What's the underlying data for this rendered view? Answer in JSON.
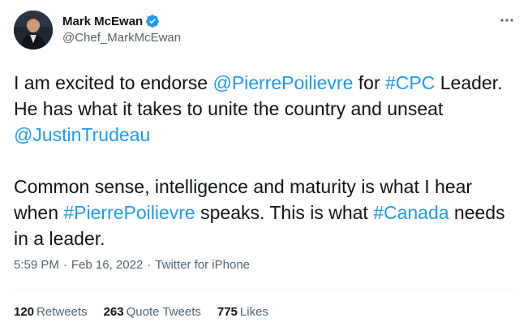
{
  "author": {
    "display_name": "Mark McEwan",
    "handle": "@Chef_MarkMcEwan",
    "verified": true,
    "avatar_icon": "profile-photo"
  },
  "tweet": {
    "p1_a": "I am excited to endorse ",
    "p1_mention1": "@PierrePoilievre",
    "p1_b": " for ",
    "p1_hashtag1": "#CPC",
    "p1_c": " Leader. He has what it takes to unite the country and unseat ",
    "p1_mention2": "@JustinTrudeau",
    "p2_a": "Common sense, intelligence and maturity is what I hear when ",
    "p2_hashtag1": "#PierrePoilievre",
    "p2_b": " speaks. This is what ",
    "p2_hashtag2": "#Canada",
    "p2_c": " needs in a leader."
  },
  "meta": {
    "time": "5:59 PM",
    "separator": "·",
    "date": "Feb 16, 2022",
    "source": "Twitter for iPhone"
  },
  "stats": {
    "retweets_count": "120",
    "retweets_label": "Retweets",
    "quotes_count": "263",
    "quotes_label": "Quote Tweets",
    "likes_count": "775",
    "likes_label": "Likes"
  },
  "colors": {
    "link": "#1d9bf0",
    "text": "#0f1419",
    "secondary": "#536471",
    "verified": "#1d9bf0"
  }
}
